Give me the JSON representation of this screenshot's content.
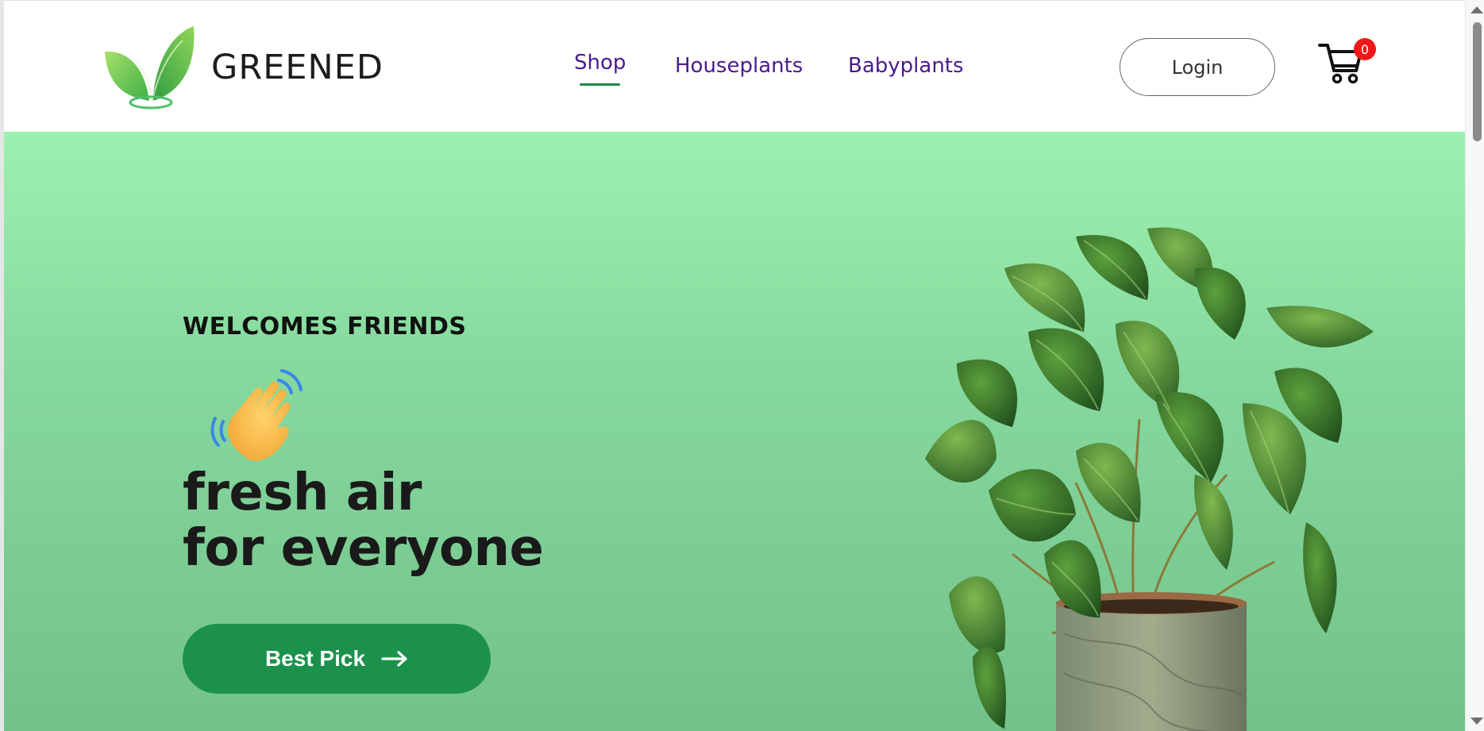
{
  "brand": {
    "name": "GREENED",
    "logo_icon": "leaf-sprout-icon"
  },
  "nav": {
    "items": [
      {
        "label": "Shop",
        "active": true
      },
      {
        "label": "Houseplants",
        "active": false
      },
      {
        "label": "Babyplants",
        "active": false
      }
    ]
  },
  "header": {
    "login_label": "Login",
    "cart_icon": "shopping-cart-icon",
    "cart_count": "0"
  },
  "hero": {
    "eyebrow": "WELCOMES FRIENDS",
    "wave_icon": "waving-hand-icon",
    "headline_line1": "fresh air",
    "headline_line2": "for everyone",
    "cta_label": "Best Pick",
    "cta_icon": "arrow-right-icon",
    "image": "potted-plant-image"
  },
  "colors": {
    "brand_green": "#1b914c",
    "nav_text": "#4a1b8c",
    "hero_top": "#9cf1b0",
    "hero_bottom": "#72c18a",
    "badge_red": "#f01818"
  }
}
